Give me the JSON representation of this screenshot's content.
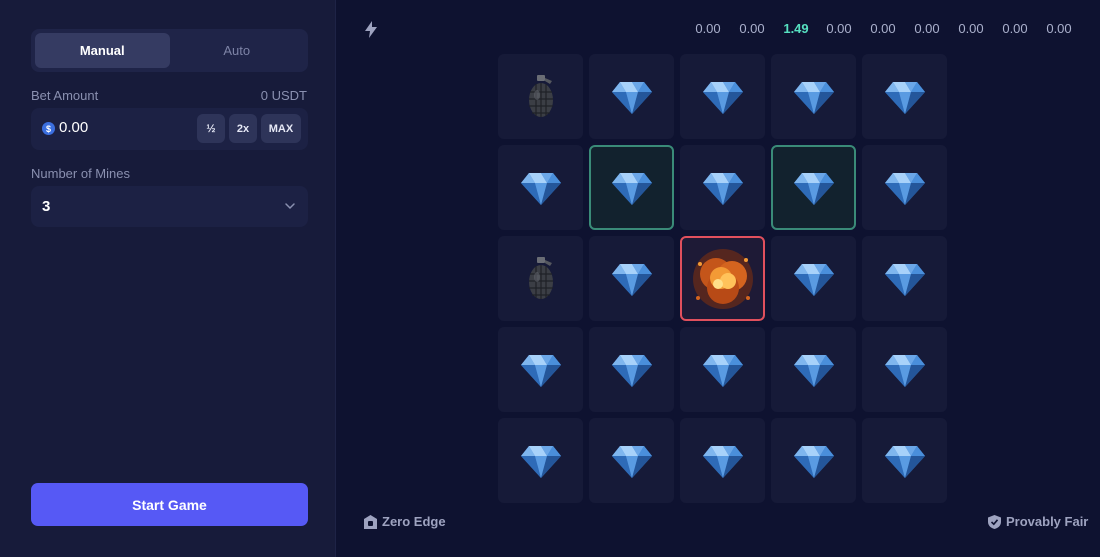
{
  "sidebar": {
    "mode_tabs": [
      {
        "label": "Manual",
        "active": true
      },
      {
        "label": "Auto",
        "active": false
      }
    ],
    "bet": {
      "label": "Bet Amount",
      "balance": "0 USDT",
      "value": "0.00",
      "half_label": "½",
      "double_label": "2x",
      "max_label": "MAX"
    },
    "mines": {
      "label": "Number of Mines",
      "value": "3"
    },
    "start_label": "Start Game"
  },
  "multipliers": [
    "0.00",
    "0.00",
    "1.49",
    "0.00",
    "0.00",
    "0.00",
    "0.00",
    "0.00",
    "0.00"
  ],
  "active_multiplier_index": 2,
  "board": {
    "rows": 5,
    "cols": 5,
    "tiles": [
      "mine",
      "gem",
      "gem",
      "gem",
      "gem",
      "gem",
      "gem-picked",
      "gem",
      "gem-picked",
      "gem",
      "mine",
      "gem",
      "explosion",
      "gem",
      "gem",
      "gem",
      "gem",
      "gem",
      "gem",
      "gem",
      "gem",
      "gem",
      "gem",
      "gem",
      "gem"
    ]
  },
  "footer": {
    "left_label": "Zero Edge",
    "right_label": "Provably Fair"
  },
  "colors": {
    "accent": "#5659f5",
    "win": "#56e0c0",
    "picked_border": "#3a8b78",
    "explosion_border": "#e0505d"
  }
}
